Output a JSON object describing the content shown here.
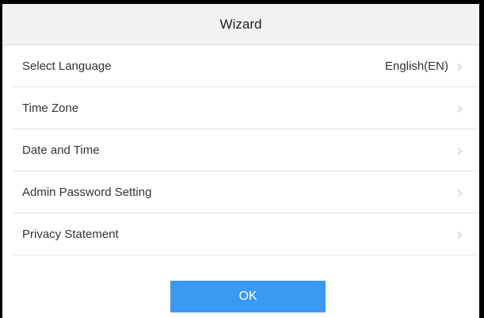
{
  "dialog": {
    "title": "Wizard"
  },
  "menu": {
    "items": [
      {
        "label": "Select Language",
        "value": "English(EN)",
        "icon": "chevron-right-icon"
      },
      {
        "label": "Time Zone",
        "value": "",
        "icon": "chevron-right-icon"
      },
      {
        "label": "Date and Time",
        "value": "",
        "icon": "chevron-right-icon"
      },
      {
        "label": "Admin Password Setting",
        "value": "",
        "icon": "chevron-right-icon"
      },
      {
        "label": "Privacy Statement",
        "value": "",
        "icon": "chevron-right-icon"
      }
    ]
  },
  "actions": {
    "ok_label": "OK"
  },
  "colors": {
    "accent": "#3a99f2",
    "header_background": "#f2f2f2",
    "divider": "#e2e2e2",
    "chevron": "#c0c0c0"
  }
}
